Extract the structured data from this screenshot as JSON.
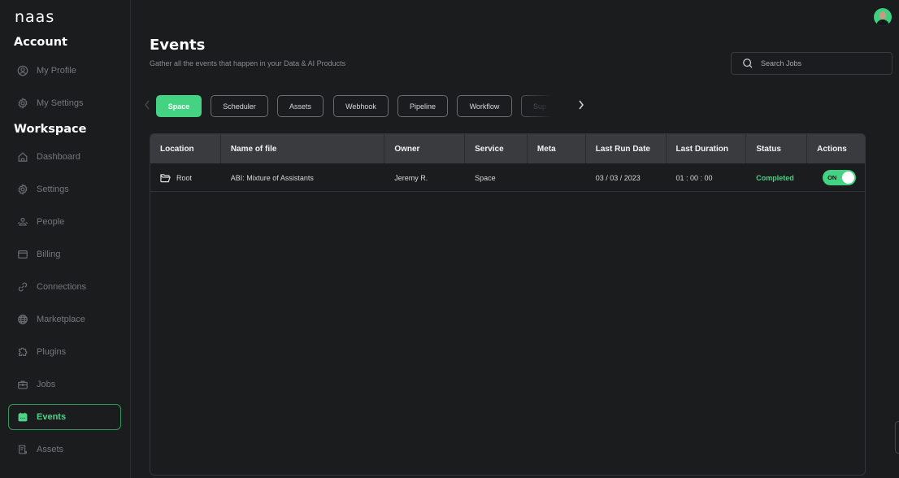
{
  "app": {
    "logo": "naas"
  },
  "sidebar": {
    "account_title": "Account",
    "account_items": [
      {
        "label": "My Profile",
        "icon": "user-circle-icon"
      },
      {
        "label": "My Settings",
        "icon": "gear-icon"
      }
    ],
    "workspace_title": "Workspace",
    "workspace_items": [
      {
        "label": "Dashboard",
        "icon": "home-icon"
      },
      {
        "label": "Settings",
        "icon": "gear-icon"
      },
      {
        "label": "People",
        "icon": "people-icon"
      },
      {
        "label": "Billing",
        "icon": "credit-card-icon"
      },
      {
        "label": "Connections",
        "icon": "link-icon"
      },
      {
        "label": "Marketplace",
        "icon": "globe-icon"
      },
      {
        "label": "Plugins",
        "icon": "puzzle-icon"
      },
      {
        "label": "Jobs",
        "icon": "briefcase-icon"
      },
      {
        "label": "Events",
        "icon": "calendar-icon",
        "active": true
      },
      {
        "label": "Assets",
        "icon": "document-icon"
      }
    ]
  },
  "header": {
    "title": "Events",
    "subtitle": "Gather all the events that happen in your Data & AI Products",
    "search": {
      "placeholder": "Search Jobs",
      "value": ""
    }
  },
  "filter_tabs": [
    {
      "label": "Space",
      "active": true
    },
    {
      "label": "Scheduler"
    },
    {
      "label": "Assets"
    },
    {
      "label": "Webhook"
    },
    {
      "label": "Pipeline"
    },
    {
      "label": "Workflow"
    },
    {
      "label": "Sup"
    }
  ],
  "table": {
    "columns": [
      "Location",
      "Name of file",
      "Owner",
      "Service",
      "Meta",
      "Last Run Date",
      "Last Duration",
      "Status",
      "Actions"
    ],
    "rows": [
      {
        "location": "Root",
        "name": "ABI: Mixture of Assistants",
        "owner": "Jeremy R.",
        "service": "Space",
        "meta": "",
        "last_run_date": "03 / 03 / 2023",
        "last_duration": "01 : 00 : 00",
        "status": "Completed",
        "action_toggle": "ON"
      }
    ]
  },
  "colors": {
    "accent": "#44d383",
    "background": "#1b1c1e",
    "table_header": "#3a3b3f",
    "muted_text": "#76777b"
  }
}
